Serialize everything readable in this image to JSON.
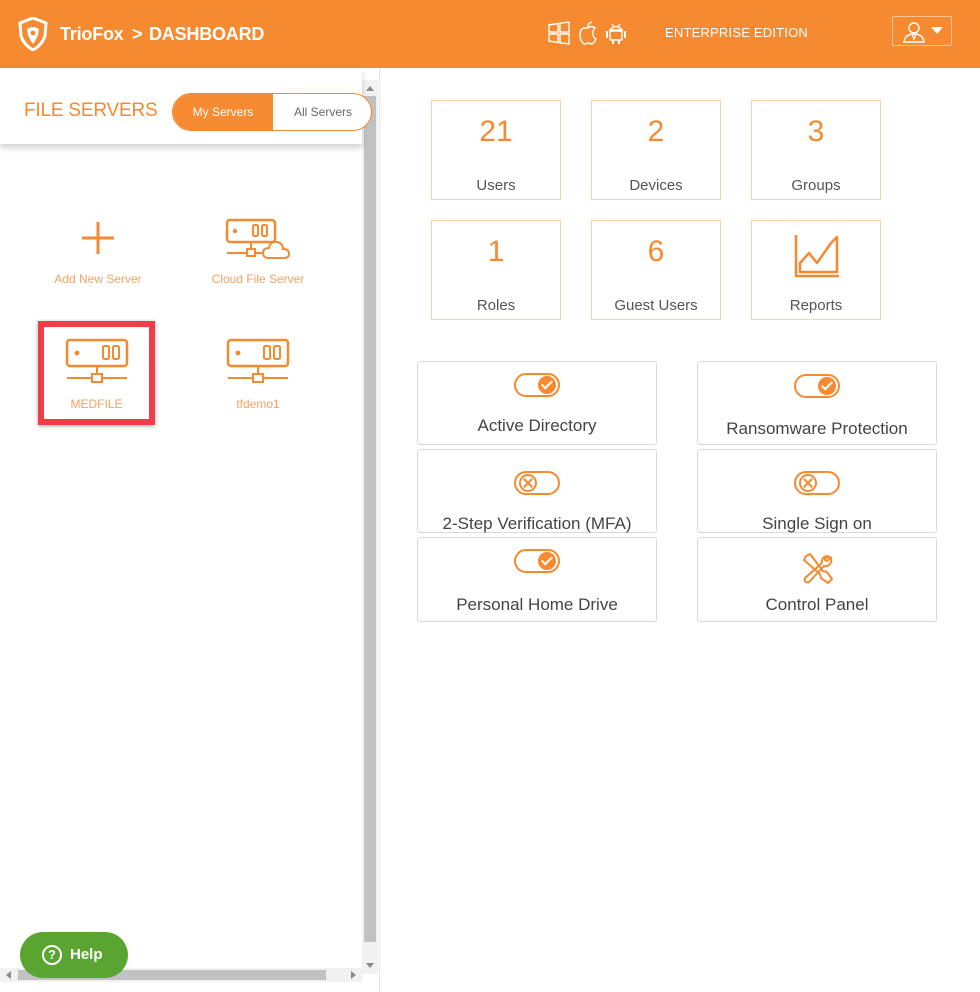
{
  "header": {
    "brand": "TrioFox",
    "separator": ">",
    "breadcrumb": "DASHBOARD",
    "edition": "ENTERPRISE EDITION",
    "platform_icons": [
      "windows-icon",
      "apple-icon",
      "android-icon"
    ],
    "user_icon": "user-icon"
  },
  "colors": {
    "accent": "#f58a31",
    "highlight": "#ef3e48",
    "help": "#5aa532"
  },
  "file_servers": {
    "title": "FILE SERVERS",
    "tabs": [
      {
        "label": "My Servers",
        "active": true
      },
      {
        "label": "All Servers",
        "active": false
      }
    ],
    "items": [
      {
        "label": "Add New Server",
        "icon": "plus-icon"
      },
      {
        "label": "Cloud File Server",
        "icon": "cloud-server-icon"
      },
      {
        "label": "MEDFILE",
        "icon": "server-icon",
        "highlighted": true
      },
      {
        "label": "tfdemo1",
        "icon": "server-icon"
      }
    ]
  },
  "help": {
    "label": "Help"
  },
  "stats": [
    {
      "value": "21",
      "label": "Users"
    },
    {
      "value": "2",
      "label": "Devices"
    },
    {
      "value": "3",
      "label": "Groups"
    },
    {
      "value": "1",
      "label": "Roles"
    },
    {
      "value": "6",
      "label": "Guest Users"
    },
    {
      "value": "",
      "label": "Reports",
      "icon": "chart-icon"
    }
  ],
  "features": [
    {
      "label": "Active Directory",
      "enabled": true
    },
    {
      "label": "Ransomware Protection",
      "enabled": true
    },
    {
      "label": "2-Step Verification (MFA)",
      "enabled": false
    },
    {
      "label": "Single Sign on",
      "enabled": false
    },
    {
      "label": "Personal Home Drive",
      "enabled": true
    },
    {
      "label": "Control Panel",
      "icon": "tools-icon"
    }
  ]
}
